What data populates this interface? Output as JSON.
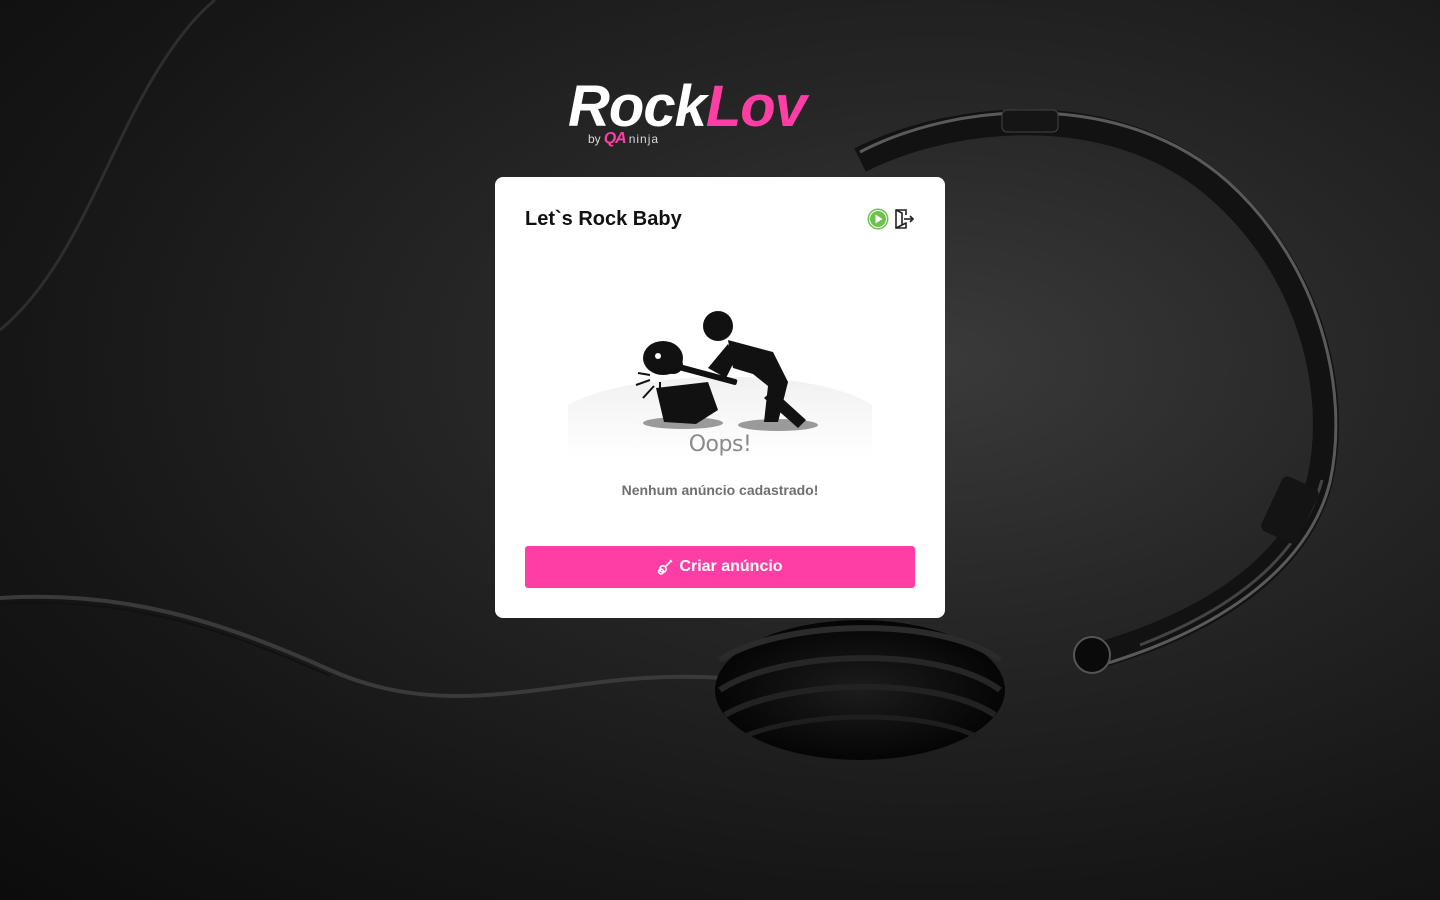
{
  "brand": {
    "logo_primary": "Rock",
    "logo_accent": "Lov",
    "by_text": "by",
    "qa_mark": "QA",
    "ninja_text": "ninja"
  },
  "card": {
    "title": "Let`s Rock Baby",
    "empty_state": {
      "heading": "Oops!",
      "message": "Nenhum anúncio cadastrado!"
    },
    "create_button_label": "Criar anúncio"
  },
  "icons": {
    "header": [
      "play-icon",
      "logout-icon"
    ],
    "button": "guitar-icon"
  },
  "colors": {
    "accent": "#ff3ea5",
    "play_icon": "#6cc24a",
    "card_bg": "#ffffff",
    "text_muted": "#6f6f6f"
  }
}
